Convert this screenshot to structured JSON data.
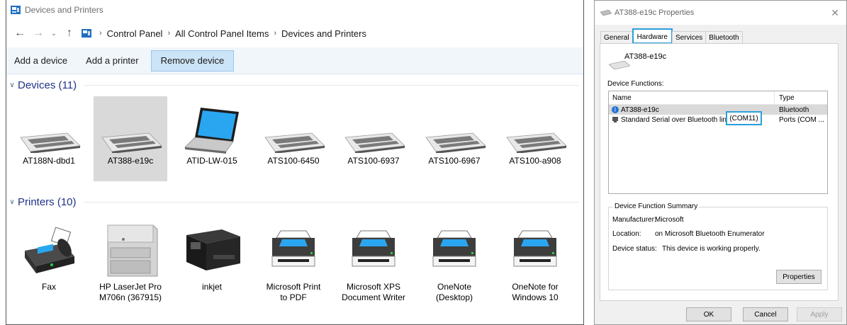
{
  "devices_window": {
    "title": "Devices and Printers",
    "breadcrumb": [
      "Control Panel",
      "All Control Panel Items",
      "Devices and Printers"
    ],
    "commands": [
      "Add a device",
      "Add a printer",
      "Remove device"
    ],
    "devices_group": "Devices (11)",
    "devices": [
      "AT188N-dbd1",
      "AT388-e19c",
      "ATID-LW-015",
      "ATS100-6450",
      "ATS100-6937",
      "ATS100-6967",
      "ATS100-a908"
    ],
    "printers_group": "Printers (10)",
    "printers": [
      {
        "line1": "Fax",
        "line2": ""
      },
      {
        "line1": "HP LaserJet Pro",
        "line2": "M706n (367915)"
      },
      {
        "line1": "inkjet",
        "line2": ""
      },
      {
        "line1": "Microsoft Print",
        "line2": "to PDF"
      },
      {
        "line1": "Microsoft XPS",
        "line2": "Document Writer"
      },
      {
        "line1": "OneNote",
        "line2": "(Desktop)"
      },
      {
        "line1": "OneNote for",
        "line2": "Windows 10"
      }
    ]
  },
  "properties_window": {
    "title": "AT388-e19c Properties",
    "tabs": [
      "General",
      "Hardware",
      "Services",
      "Bluetooth"
    ],
    "device_name": "AT388-e19c",
    "functions_label": "Device Functions:",
    "columns": [
      "Name",
      "Type"
    ],
    "rows": [
      {
        "name": "AT388-e19c",
        "type": "Bluetooth"
      },
      {
        "name": "Standard Serial over Bluetooth link",
        "type": "Ports (COM ..."
      }
    ],
    "com_port": "(COM11)",
    "summary_title": "Device Function Summary",
    "manufacturer_label": "Manufacturer:",
    "manufacturer": "Microsoft",
    "location_label": "Location:",
    "location": "on Microsoft Bluetooth Enumerator",
    "status_label": "Device status:",
    "status": "This device is working properly.",
    "properties_button": "Properties",
    "ok_button": "OK",
    "cancel_button": "Cancel",
    "apply_button": "Apply"
  }
}
